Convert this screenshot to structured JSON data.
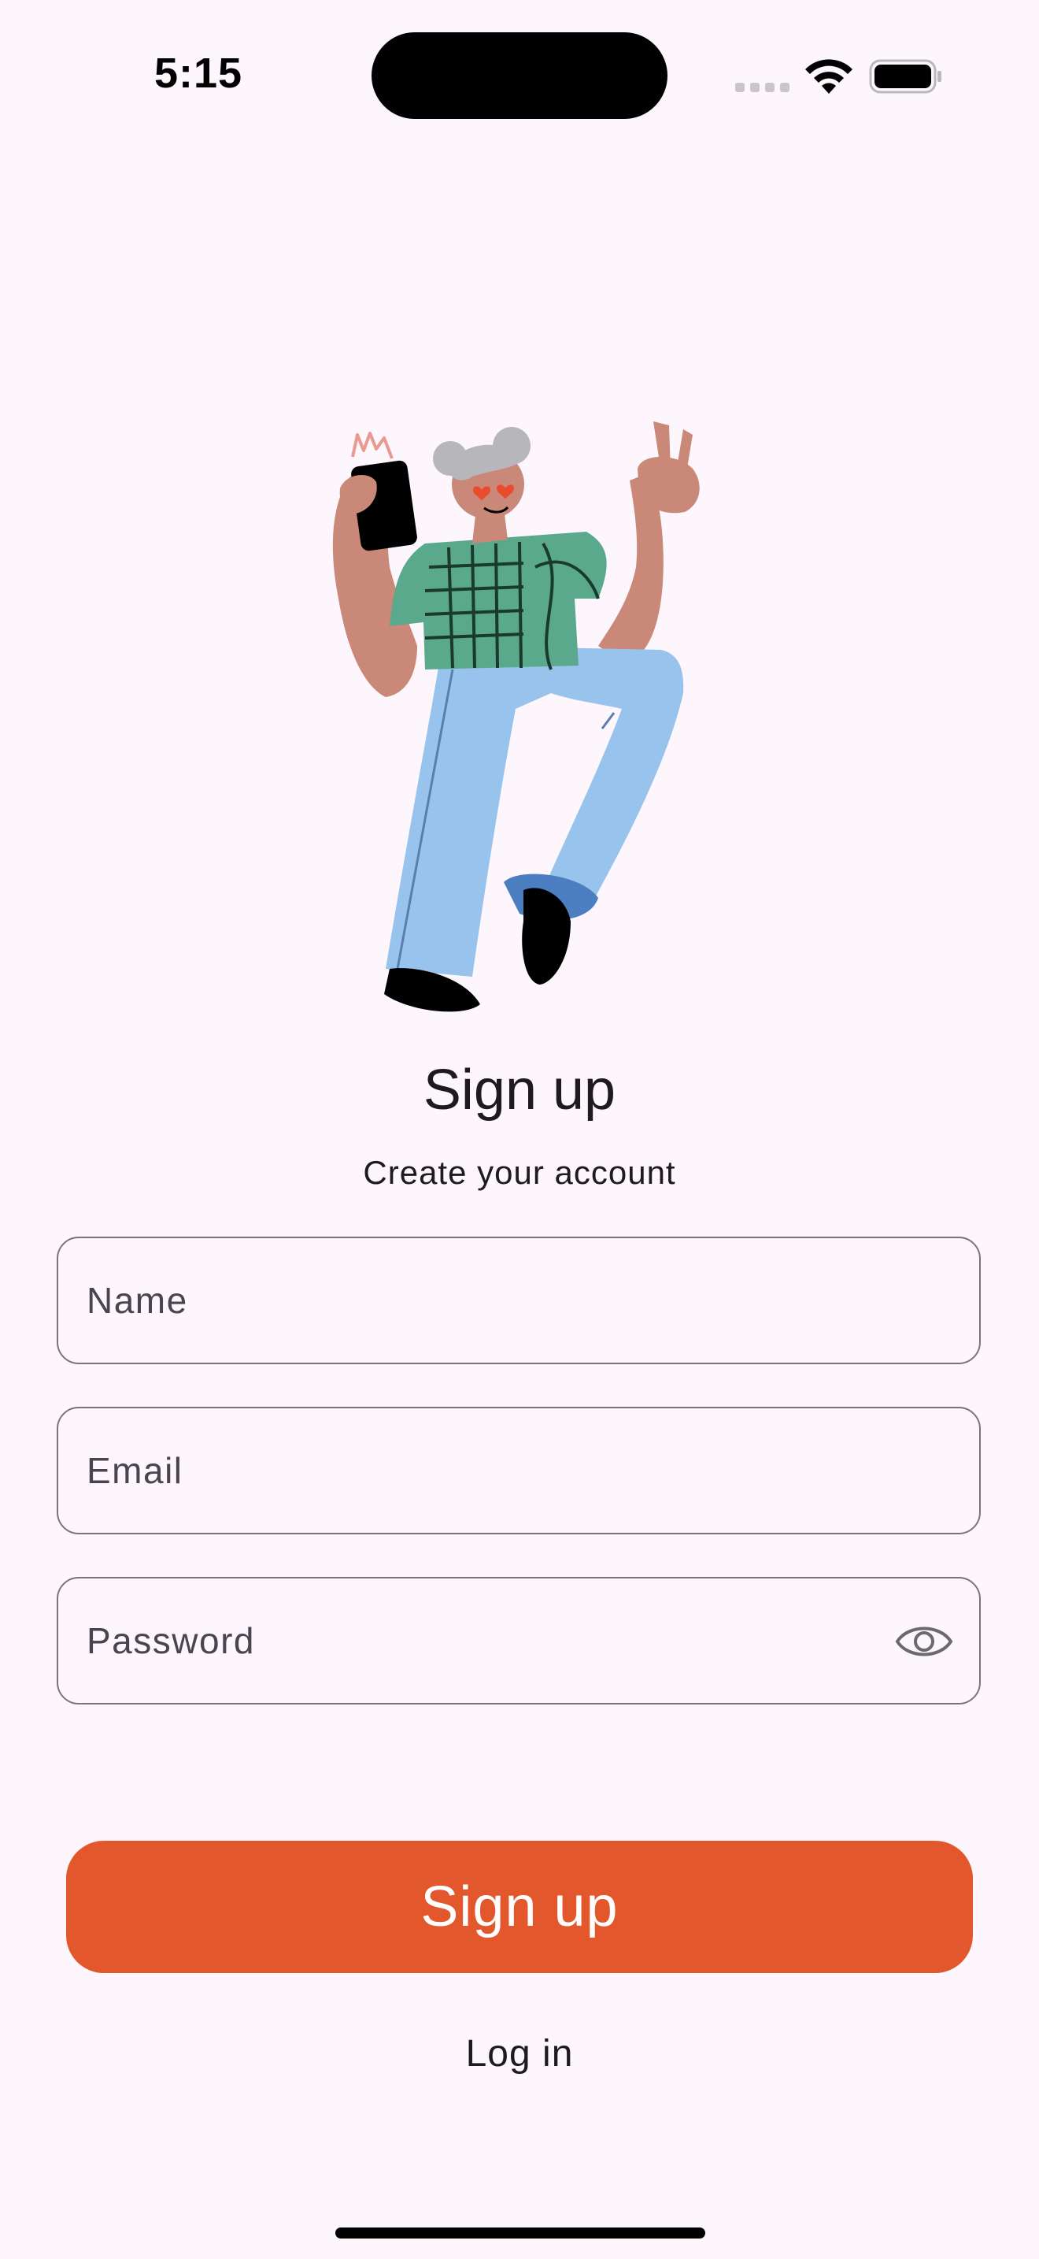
{
  "status_bar": {
    "time": "5:15"
  },
  "illustration": {
    "icon": "person-dancing-with-phone-illustration"
  },
  "header": {
    "title": "Sign up",
    "subtitle": "Create your account"
  },
  "form": {
    "name": {
      "placeholder": "Name",
      "value": ""
    },
    "email": {
      "placeholder": "Email",
      "value": ""
    },
    "password": {
      "placeholder": "Password",
      "value": "",
      "toggle_icon": "eye-icon"
    }
  },
  "actions": {
    "signup_label": "Sign up",
    "login_label": "Log in"
  },
  "colors": {
    "background": "#fdf6fc",
    "accent": "#e2582c",
    "field_border": "#79747e"
  }
}
